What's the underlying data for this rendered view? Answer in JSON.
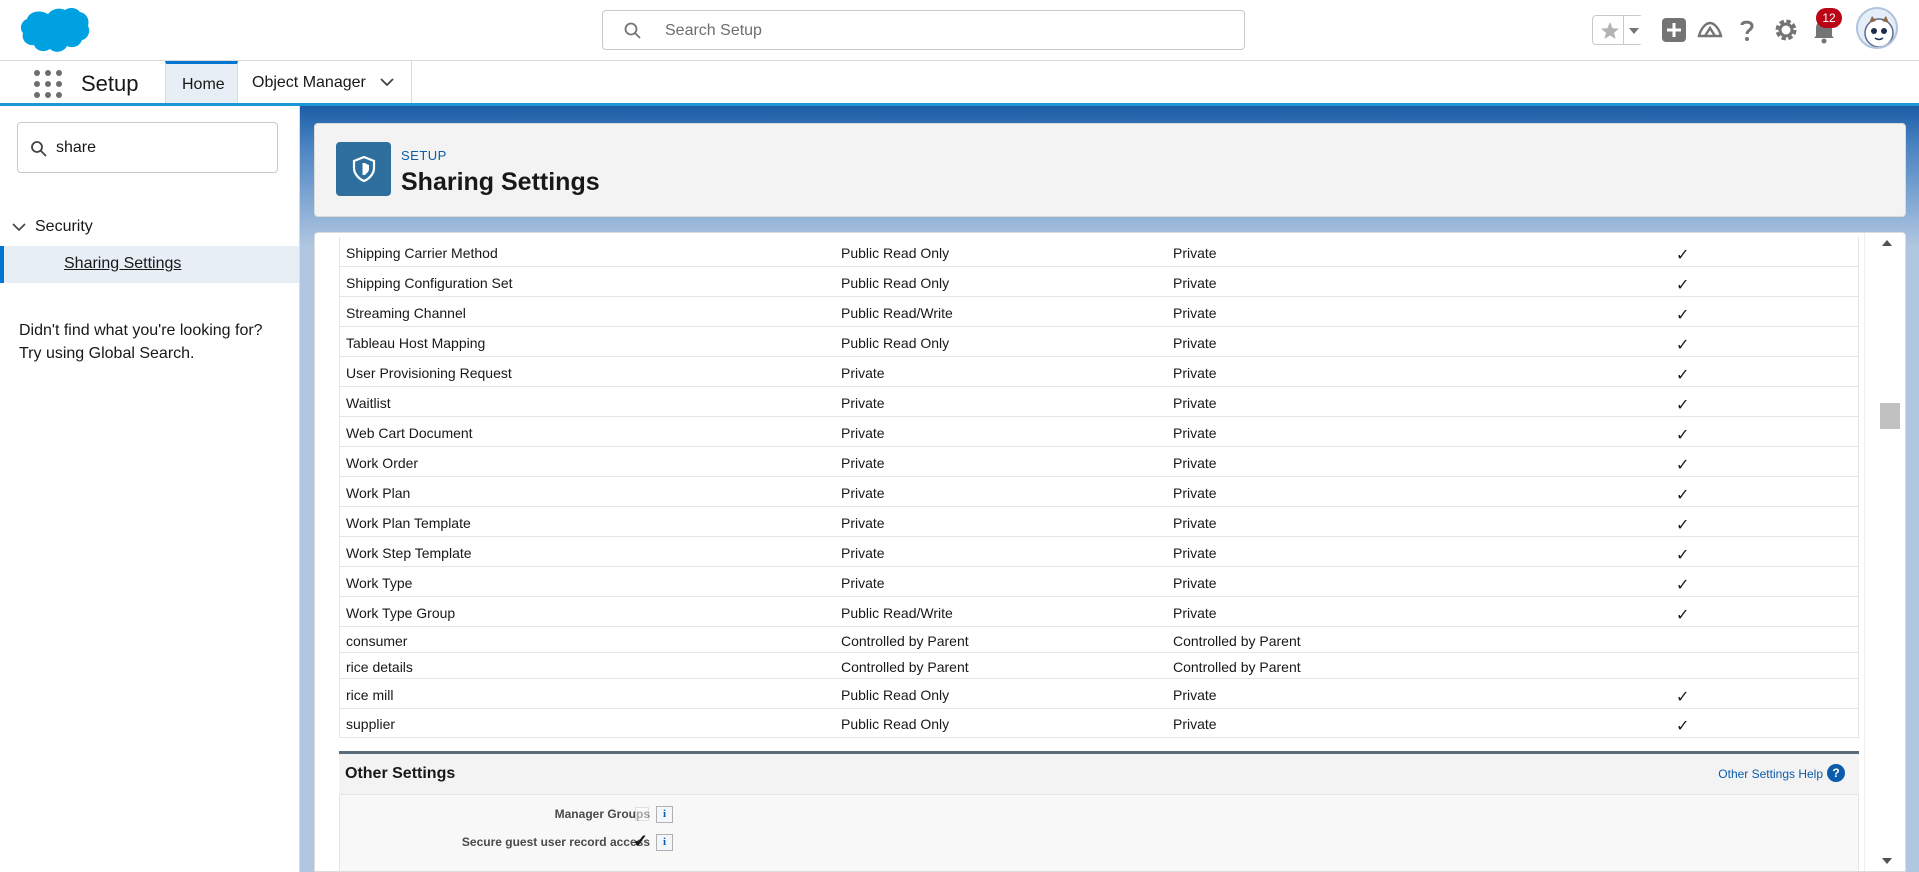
{
  "header": {
    "search_placeholder": "Search Setup",
    "notification_count": "12",
    "icons": [
      "salesforce-cloud-logo",
      "search-icon",
      "star-icon",
      "chevron-down-icon",
      "add-icon",
      "trailhead-icon",
      "help-icon",
      "gear-icon",
      "bell-icon",
      "avatar"
    ]
  },
  "nav": {
    "app_title": "Setup",
    "tabs": [
      {
        "label": "Home",
        "active": true
      },
      {
        "label": "Object Manager",
        "active": false
      }
    ]
  },
  "sidebar": {
    "quick_find_value": "share",
    "section": "Security",
    "item": "Sharing Settings",
    "not_found_line1": "Didn't find what you're looking for?",
    "not_found_line2": "Try using Global Search."
  },
  "page": {
    "breadcrumb": "SETUP",
    "title": "Sharing Settings"
  },
  "table": {
    "rows": [
      {
        "object": "Shipping Carrier Method",
        "internal": "Public Read Only",
        "external": "Private",
        "grant": "✓"
      },
      {
        "object": "Shipping Configuration Set",
        "internal": "Public Read Only",
        "external": "Private",
        "grant": "✓"
      },
      {
        "object": "Streaming Channel",
        "internal": "Public Read/Write",
        "external": "Private",
        "grant": "✓"
      },
      {
        "object": "Tableau Host Mapping",
        "internal": "Public Read Only",
        "external": "Private",
        "grant": "✓"
      },
      {
        "object": "User Provisioning Request",
        "internal": "Private",
        "external": "Private",
        "grant": "✓"
      },
      {
        "object": "Waitlist",
        "internal": "Private",
        "external": "Private",
        "grant": "✓"
      },
      {
        "object": "Web Cart Document",
        "internal": "Private",
        "external": "Private",
        "grant": "✓"
      },
      {
        "object": "Work Order",
        "internal": "Private",
        "external": "Private",
        "grant": "✓"
      },
      {
        "object": "Work Plan",
        "internal": "Private",
        "external": "Private",
        "grant": "✓"
      },
      {
        "object": "Work Plan Template",
        "internal": "Private",
        "external": "Private",
        "grant": "✓"
      },
      {
        "object": "Work Step Template",
        "internal": "Private",
        "external": "Private",
        "grant": "✓"
      },
      {
        "object": "Work Type",
        "internal": "Private",
        "external": "Private",
        "grant": "✓"
      },
      {
        "object": "Work Type Group",
        "internal": "Public Read/Write",
        "external": "Private",
        "grant": "✓"
      },
      {
        "object": "consumer",
        "internal": "Controlled by Parent",
        "external": "Controlled by Parent",
        "grant": ""
      },
      {
        "object": "rice details",
        "internal": "Controlled by Parent",
        "external": "Controlled by Parent",
        "grant": ""
      },
      {
        "object": "rice mill",
        "internal": "Public Read Only",
        "external": "Private",
        "grant": "✓"
      },
      {
        "object": "supplier",
        "internal": "Public Read Only",
        "external": "Private",
        "grant": "✓"
      }
    ]
  },
  "other_settings": {
    "title": "Other Settings",
    "help_link": "Other Settings Help",
    "help_glyph": "?",
    "info_glyph": "i",
    "settings": [
      {
        "label": "Manager Groups",
        "checked": false,
        "checkmark": ""
      },
      {
        "label": "Secure guest user record access",
        "checked": true,
        "checkmark": "✓"
      }
    ]
  },
  "colors": {
    "brand_blue": "#0176d3",
    "header_icon_bg": "#2e6f9e",
    "badge_red": "#ba0517"
  }
}
